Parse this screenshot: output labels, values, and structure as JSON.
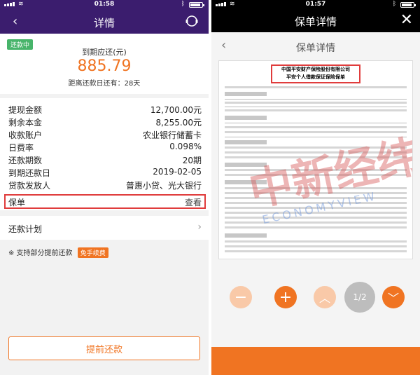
{
  "left": {
    "status": {
      "time": "01:58"
    },
    "header": {
      "title": "详情",
      "back_icon": "back-chevron-icon",
      "service_icon": "customer-service-icon"
    },
    "summary": {
      "badge": "还款中",
      "due_label": "到期应还(元)",
      "due_amount": "885.79",
      "days_left": "距离还款日还有：28天"
    },
    "details": [
      {
        "key": "提现金额",
        "value": "12,700.00元"
      },
      {
        "key": "剩余本金",
        "value": "8,255.00元"
      },
      {
        "key": "收款账户",
        "value": "农业银行储蓄卡"
      },
      {
        "key": "日费率",
        "value": "0.098%"
      },
      {
        "key": "还款期数",
        "value": "20期"
      },
      {
        "key": "到期还款日",
        "value": "2019-02-05"
      },
      {
        "key": "贷款发放人",
        "value": "普惠小贷、光大银行"
      }
    ],
    "policy": {
      "label": "保单",
      "link": "查看"
    },
    "plan": {
      "label": "还款计划"
    },
    "note": {
      "text": "※  支持部分提前还款",
      "pill": "免手续费"
    },
    "repay_button": "提前还款"
  },
  "right": {
    "status": {
      "time": "01:57"
    },
    "top": {
      "title": "保单详情",
      "close_icon": "close-icon"
    },
    "subhead": {
      "title": "保单详情",
      "back_icon": "back-chevron-icon"
    },
    "doc": {
      "title1": "中国平安财产保险股份有限公司",
      "title2": "平安个人借款保证保险保单",
      "watermark_cn": "中新经纬",
      "watermark_en": "ECONOMYVIEW"
    },
    "controls": {
      "zoom_out_icon": "minus-icon",
      "zoom_in_icon": "plus-icon",
      "prev_icon": "chevron-up-icon",
      "page": "1/2",
      "next_icon": "chevron-down-icon"
    }
  },
  "colors": {
    "left_header": "#3b1d6e",
    "accent": "#f07422",
    "badge": "#47b46a",
    "highlight": "#e03c3c"
  }
}
